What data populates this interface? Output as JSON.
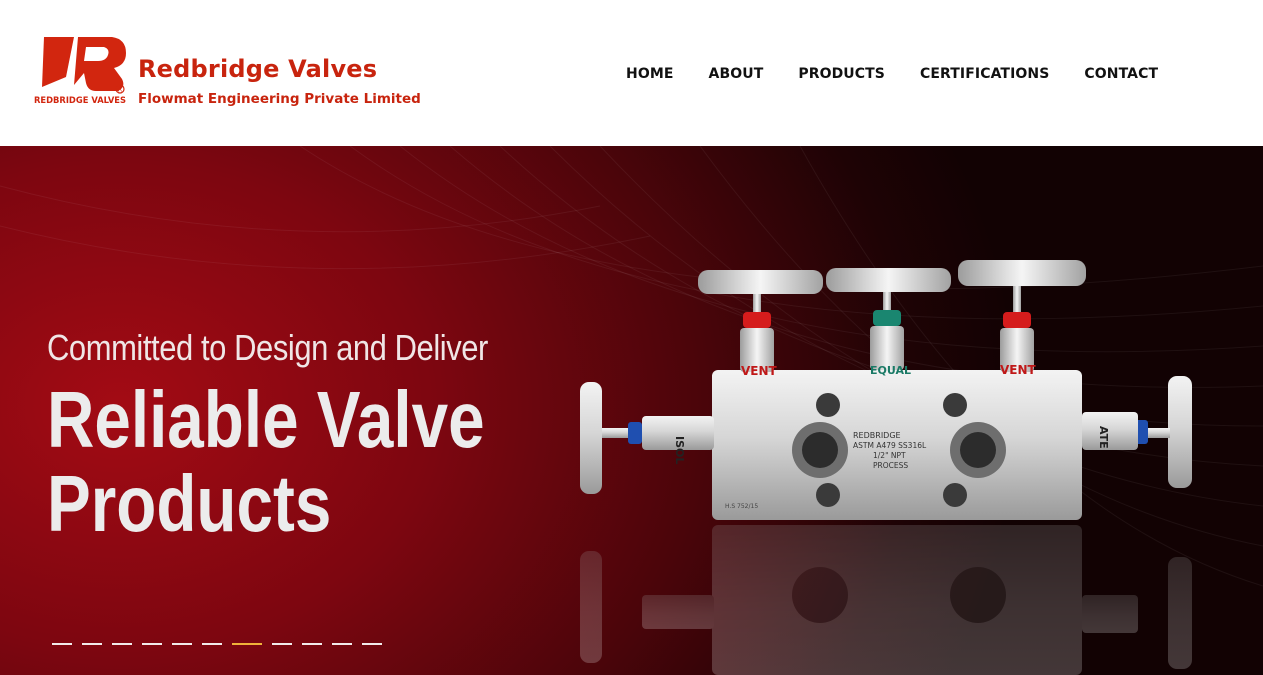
{
  "header": {
    "brand_title": "Redbridge Valves",
    "brand_subtitle": "Flowmat Engineering Private Limited",
    "logo_caption": "REDBRIDGE VALVES",
    "logo_mark": "R",
    "accent_color": "#c8240e"
  },
  "nav": {
    "items": [
      {
        "label": "HOME"
      },
      {
        "label": "ABOUT"
      },
      {
        "label": "PRODUCTS"
      },
      {
        "label": "CERTIFICATIONS"
      },
      {
        "label": "CONTACT"
      }
    ]
  },
  "hero": {
    "tagline": "Committed to Design and Deliver",
    "headline_line1": "Reliable Valve",
    "headline_line2": "Products",
    "product_labels": {
      "brand": "REDBRIDGE",
      "material": "ASTM A479 SS316L",
      "size": "1/2\" NPT",
      "port": "PROCESS",
      "heat_number": "H.S 752/15",
      "vent_left": "VENT",
      "equal": "EQUAL",
      "vent_right": "VENT",
      "isolate_left": "ISOL",
      "isolate_right": "ATE"
    },
    "slider": {
      "total_slides": 11,
      "active_index": 6
    }
  }
}
